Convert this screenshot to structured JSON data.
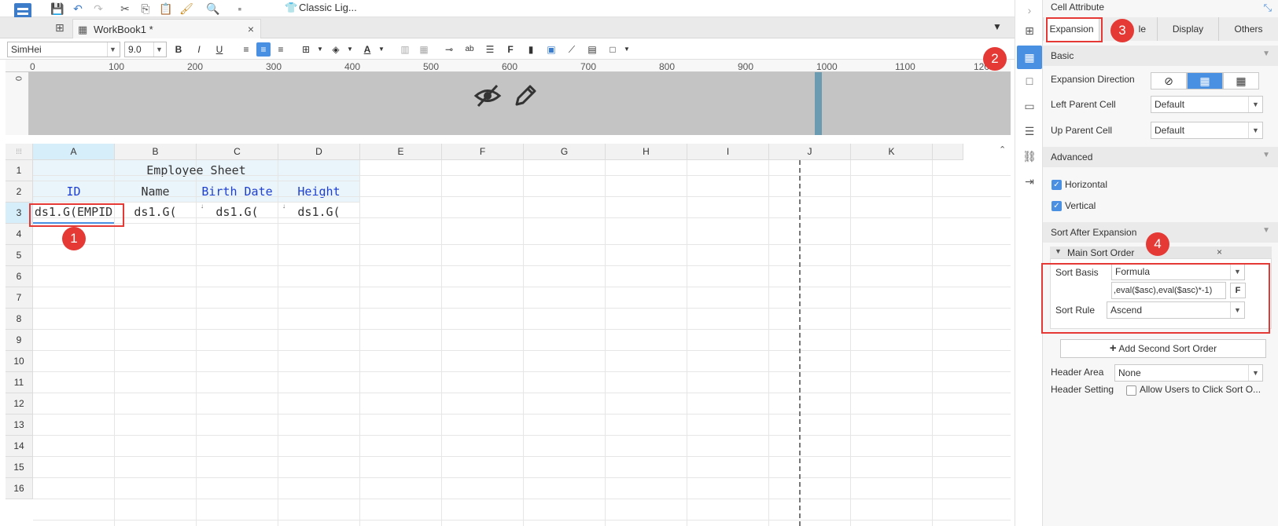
{
  "toolbar": {
    "template_label": "Classic Lig..."
  },
  "tab": {
    "name": "WorkBook1 *",
    "close": "×"
  },
  "format": {
    "font": "SimHei",
    "size": "9.0"
  },
  "ruler": {
    "ticks": [
      "0",
      "100",
      "200",
      "300",
      "400",
      "500",
      "600",
      "700",
      "800",
      "900",
      "1000",
      "1100",
      "120"
    ],
    "vzero": "0"
  },
  "sheet": {
    "columns": [
      "A",
      "B",
      "C",
      "D",
      "E",
      "F",
      "G",
      "H",
      "I",
      "J",
      "K"
    ],
    "rows": [
      "1",
      "2",
      "3",
      "4",
      "5",
      "6",
      "7",
      "8",
      "9",
      "10",
      "11",
      "12",
      "13",
      "14",
      "15",
      "16"
    ],
    "title": "Employee Sheet",
    "headers": [
      "ID",
      "Name",
      "Birth Date",
      "Height"
    ],
    "formulas": [
      "ds1.G(EMPID",
      "ds1.G(",
      "ds1.G(",
      "ds1.G("
    ]
  },
  "badges": [
    "1",
    "2",
    "3",
    "4"
  ],
  "panel": {
    "title": "Cell Attribute",
    "tabs": [
      "Expansion",
      "le",
      "Display",
      "Others"
    ],
    "basic": "Basic",
    "expansion_direction": "Expansion Direction",
    "left_parent": "Left Parent Cell",
    "left_parent_value": "Default",
    "up_parent": "Up Parent Cell",
    "up_parent_value": "Default",
    "advanced": "Advanced",
    "horizontal": "Horizontal",
    "vertical": "Vertical",
    "sort_after": "Sort After Expansion",
    "main_sort": "Main Sort Order",
    "sort_basis": "Sort Basis",
    "sort_basis_value": "Formula",
    "formula": ",eval($asc),eval($asc)*-1)",
    "sort_rule": "Sort Rule",
    "sort_rule_value": "Ascend",
    "add_second": "Add Second Sort Order",
    "header_area": "Header Area",
    "header_area_value": "None",
    "header_setting": "Header Setting",
    "allow_click": "Allow Users to Click Sort O..."
  }
}
